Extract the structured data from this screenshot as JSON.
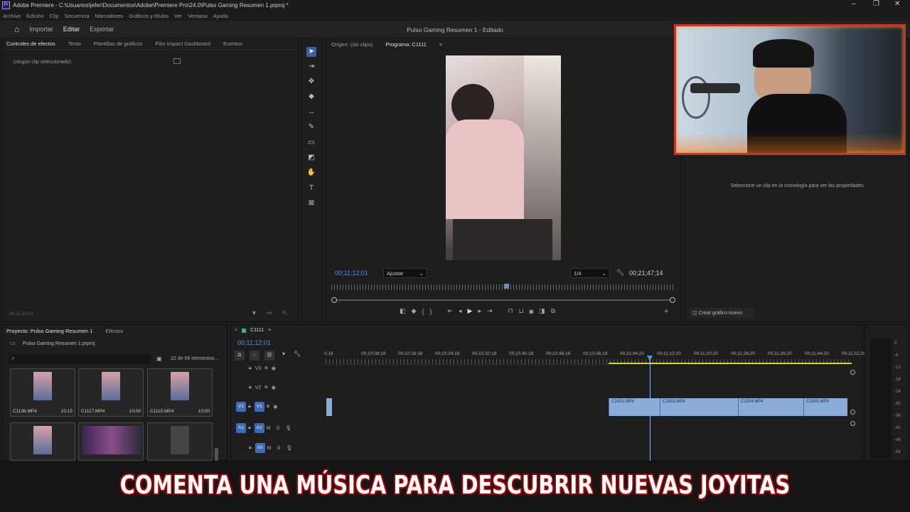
{
  "window": {
    "title": "Adobe Premiere - C:\\Usuarios\\jefer\\Documentos\\Adobe\\Premiere Pro\\24.0\\Pulso Gaming Resumen 1.prproj *",
    "logo": "Pr"
  },
  "menu": [
    "Archivo",
    "Edición",
    "Clip",
    "Secuencia",
    "Marcadores",
    "Gráficos y títulos",
    "Ver",
    "Ventana",
    "Ayuda"
  ],
  "workspace": {
    "tabs": [
      "Importar",
      "Editar",
      "Exportar"
    ],
    "active": "Editar",
    "doc_title": "Pulso Gaming Resumen 1 - Editado"
  },
  "effects_panel": {
    "tabs": [
      "Controles de efectos",
      "Texto",
      "Plantillas de gráficos",
      "Film Impact Dashboard",
      "Eventos"
    ],
    "empty_text": "(ningún clip seleccionado)",
    "timecode": "00;11;12;01"
  },
  "program": {
    "source_tab": "Origen: (sin clips)",
    "program_tab": "Programa: C1111",
    "timecode": "00;11;12;01",
    "fit": "Ajustar",
    "quality": "1/4",
    "duration": "00;21;47;14"
  },
  "props": {
    "hint": "Seleccione un clip en la cronología para ver las propiedades.",
    "new_graphic": "Crear gráfico nuevo"
  },
  "project": {
    "tabs": [
      "Proyecto: Pulso Gaming Resumen 1",
      "Efectos"
    ],
    "file": "Pulso Gaming Resumen 1.prproj",
    "count": "22 de 69 elementos...",
    "items": [
      {
        "name": "C1136.MP4",
        "dur": "10;15"
      },
      {
        "name": "C1117.MP4",
        "dur": "10;00"
      },
      {
        "name": "C1115.MP4",
        "dur": "10;00"
      },
      {
        "name": "",
        "dur": ""
      },
      {
        "name": "",
        "dur": ""
      },
      {
        "name": "",
        "dur": ""
      }
    ]
  },
  "timeline": {
    "sequence": "C1111",
    "timecode": "00;11;12;01",
    "ruler": [
      "0;18",
      "00;10;08;18",
      "00;10;16;18",
      "00;10;24;18",
      "00;10;32;18",
      "00;10;40;18",
      "00;10;48;18",
      "00;10;56;18",
      "00;11;04;20",
      "00;11;12;20",
      "00;11;20;20",
      "00;11;28;20",
      "00;11;36;20",
      "00;11;44;20",
      "00;11;52;20"
    ],
    "tracks": {
      "v3": "V3",
      "v2": "V2",
      "v1": "V1",
      "a1": "A1",
      "a2": "A2",
      "m": "M",
      "s": "S"
    },
    "clips": [
      "C1001.MP4",
      "C1003.MP4",
      "C1004.MP4",
      "C1005.MP4"
    ]
  },
  "meter_labels": [
    "0",
    "-6",
    "-12",
    "-18",
    "-24",
    "-30",
    "-36",
    "-42",
    "-48",
    "-54"
  ],
  "caption": "COMENTA UNA MÚSICA PARA DESCUBRIR NUEVAS JOYITAS"
}
